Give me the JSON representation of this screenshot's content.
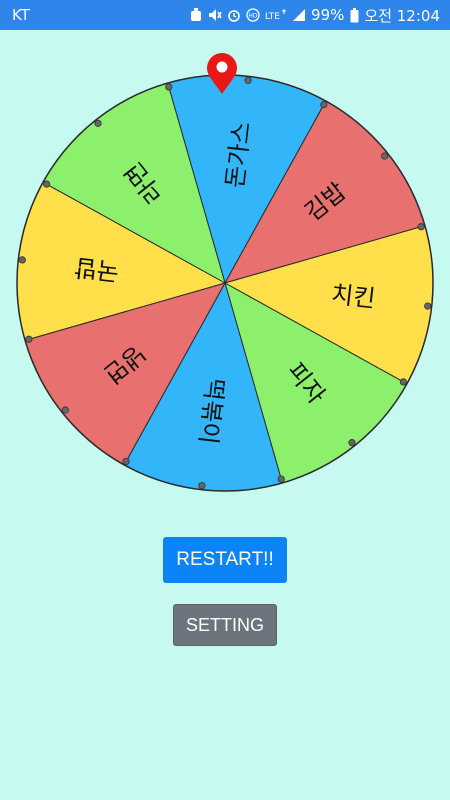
{
  "status_bar": {
    "carrier": "KT",
    "network": "LTE",
    "battery": "99%",
    "time": "오전 12:04",
    "icons": [
      "notification-icon",
      "mute-icon",
      "alarm-icon",
      "hd-icon",
      "lte-icon",
      "signal-icon",
      "battery-icon"
    ]
  },
  "wheel": {
    "segments": [
      {
        "label": "돈가스",
        "color": "#33b5f9"
      },
      {
        "label": "김밥",
        "color": "#e87170"
      },
      {
        "label": "치킨",
        "color": "#ffe04a"
      },
      {
        "label": "피자",
        "color": "#8df06d"
      },
      {
        "label": "떡볶이",
        "color": "#33b5f9"
      },
      {
        "label": "냉면",
        "color": "#e87170"
      },
      {
        "label": "국밥",
        "color": "#ffe04a"
      },
      {
        "label": "라면",
        "color": "#8df06d"
      }
    ],
    "pointer_color": "#e81818",
    "pointer_icon": "map-pin-icon"
  },
  "buttons": {
    "restart": "RESTART!!",
    "setting": "SETTING"
  },
  "colors": {
    "background": "#c6f9ef",
    "status_bar": "#2f86ea",
    "restart_button": "#0b84f8",
    "setting_button": "#6c757d"
  }
}
